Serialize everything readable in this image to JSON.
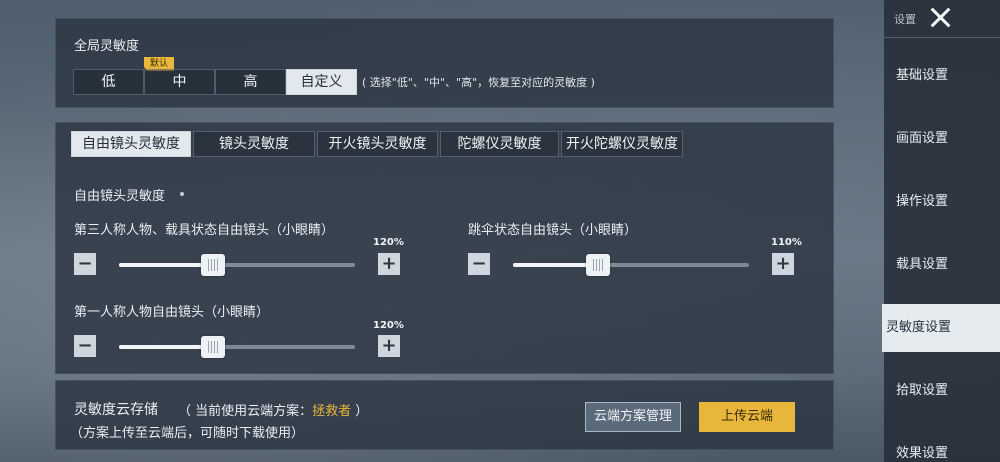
{
  "global_sensitivity": {
    "title": "全局灵敏度",
    "default_badge": "默认",
    "levels": [
      "低",
      "中",
      "高",
      "自定义"
    ],
    "active_level": "自定义",
    "hint": "( 选择\"低\"、\"中\"、\"高\"，恢复至对应的灵敏度 )"
  },
  "sensitivity": {
    "tabs": [
      "自由镜头灵敏度",
      "镜头灵敏度",
      "开火镜头灵敏度",
      "陀螺仪灵敏度",
      "开火陀螺仪灵敏度"
    ],
    "active_tab": "自由镜头灵敏度",
    "section_title": "自由镜头灵敏度",
    "sliders": [
      {
        "label": "第三人称人物、载具状态自由镜头（小眼睛）",
        "value": "120%",
        "fraction": 0.4
      },
      {
        "label": "跳伞状态自由镜头（小眼睛）",
        "value": "110%",
        "fraction": 0.36
      },
      {
        "label": "第一人称人物自由镜头（小眼睛）",
        "value": "120%",
        "fraction": 0.4
      }
    ],
    "minus": "−",
    "plus": "+"
  },
  "cloud": {
    "title": "灵敏度云存储",
    "current_prefix": "（ 当前使用云端方案：",
    "current_plan": "拯救者",
    "current_suffix": " ）",
    "description": "（方案上传至云端后，可随时下载使用）",
    "manage_button": "云端方案管理",
    "upload_button": "上传云端"
  },
  "sidebar": {
    "title": "设置",
    "items": [
      "基础设置",
      "画面设置",
      "操作设置",
      "载具设置",
      "灵敏度设置",
      "拾取设置",
      "效果设置"
    ],
    "active_item": "灵敏度设置"
  }
}
